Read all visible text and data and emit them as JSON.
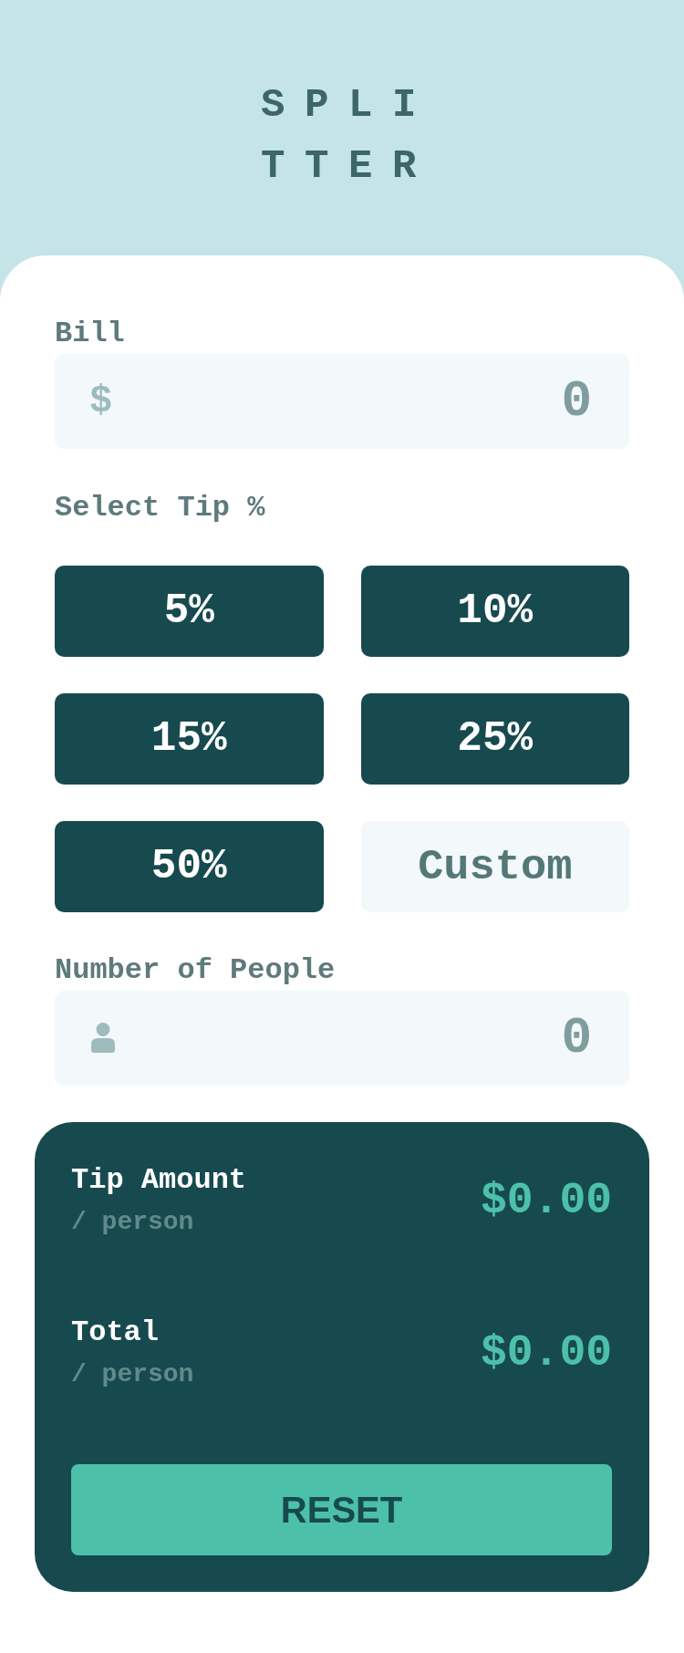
{
  "header": {
    "logo": "SPLITTER"
  },
  "bill": {
    "label": "Bill",
    "currency_symbol": "$",
    "placeholder": "0"
  },
  "tip": {
    "label": "Select Tip %",
    "options": [
      {
        "label": "5%",
        "selected": false
      },
      {
        "label": "10%",
        "selected": false
      },
      {
        "label": "15%",
        "selected": false
      },
      {
        "label": "25%",
        "selected": false
      },
      {
        "label": "50%",
        "selected": false
      }
    ],
    "custom": {
      "placeholder": "Custom"
    }
  },
  "people": {
    "label": "Number of People",
    "placeholder": "0"
  },
  "results": {
    "rows": [
      {
        "label": "Tip Amount",
        "unit": "/ person",
        "amount": "$0.00"
      },
      {
        "label": "Total",
        "unit": "/ person",
        "amount": "$0.00"
      }
    ],
    "reset_button": {
      "label": "RESET"
    }
  }
}
